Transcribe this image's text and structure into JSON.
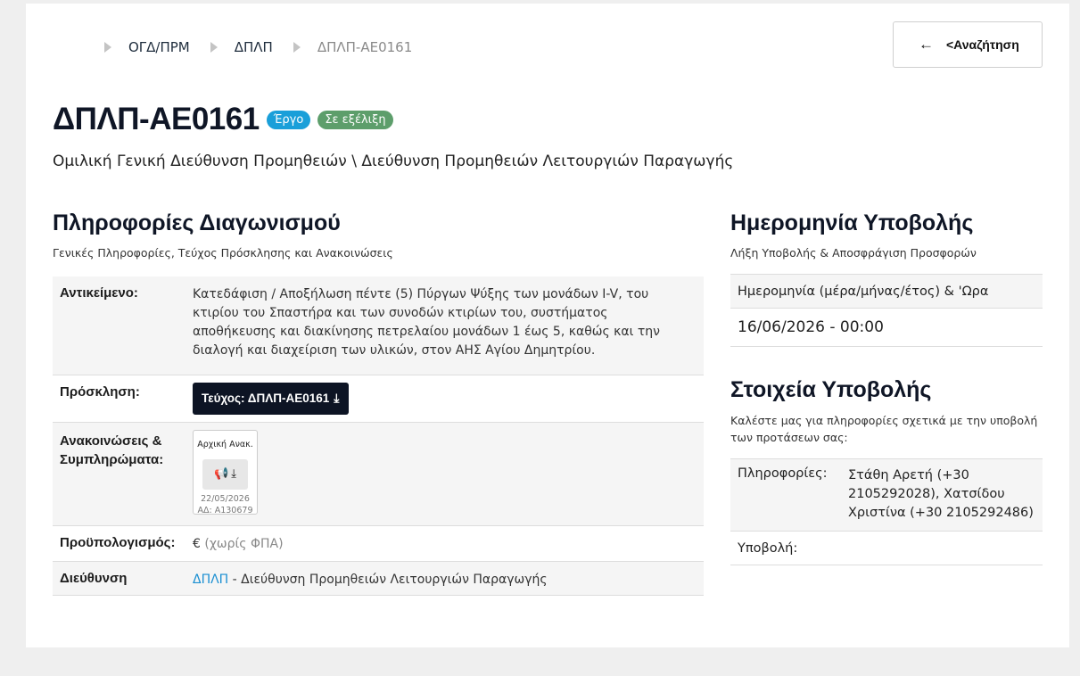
{
  "breadcrumb": [
    "ΟΓΔ/ΠΡΜ",
    "ΔΠΛΠ",
    "ΔΠΛΠ-ΑΕ0161"
  ],
  "back_button": "<Αναζήτηση",
  "title": "ΔΠΛΠ-ΑΕ0161",
  "badges": {
    "type": "Έργο",
    "status": "Σε εξέλιξη"
  },
  "subtitle": "Ομιλική Γενική Διεύθυνση Προμηθειών \\ Διεύθυνση Προμηθειών Λειτουργιών Παραγωγής",
  "tender_info": {
    "title": "Πληροφορίες Διαγωνισμού",
    "subtitle": "Γενικές Πληροφορίες, Τεύχος Πρόσκλησης και Ανακοινώσεις",
    "subject_label": "Αντικείμενο:",
    "subject_value": "Κατεδάφιση / Αποξήλωση πέντε (5) Πύργων Ψύξης των μονάδων I-V, του κτιρίου του Σπαστήρα και των συνοδών κτιρίων του, συστήματος αποθήκευσης και διακίνησης πετρελαίου μονάδων 1 έως 5, καθώς και την διαλογή και διαχείριση των υλικών, στον ΑΗΣ Αγίου Δημητρίου.",
    "invitation_label": "Πρόσκληση:",
    "invitation_button": "Τεύχος: ΔΠΛΠ-ΑΕ0161",
    "announcements_label": "Ανακοινώσεις & Συμπληρώματα:",
    "announcement": {
      "title": "Αρχική Ανακ.",
      "date": "22/05/2026",
      "ref": "ΑΔ: A130679"
    },
    "budget_label": "Προϋπολογισμός:",
    "budget_currency": "€",
    "budget_note": "(χωρίς ΦΠΑ)",
    "directorate_label": "Διεύθυνση",
    "directorate_link": "ΔΠΛΠ",
    "directorate_text": " - Διεύθυνση Προμηθειών Λειτουργιών Παραγωγής"
  },
  "submission_date": {
    "title": "Ημερομηνία Υποβολής",
    "subtitle": "Λήξη Υποβολής & Αποσφράγιση Προσφορών",
    "header": "Ημερομηνία (μέρα/μήνας/έτος) & 'Ωρα",
    "value": "16/06/2026 - 00:00"
  },
  "submission_details": {
    "title": "Στοιχεία Υποβολής",
    "subtitle": "Καλέστε μας για πληροφορίες σχετικά με την υποβολή των προτάσεων σας:",
    "info_label": "Πληροφορίες:",
    "info_value": "Στάθη Αρετή (+30 2105292028), Χατσίδου Χριστίνα (+30 2105292486)",
    "submission_label": "Υποβολή:"
  }
}
